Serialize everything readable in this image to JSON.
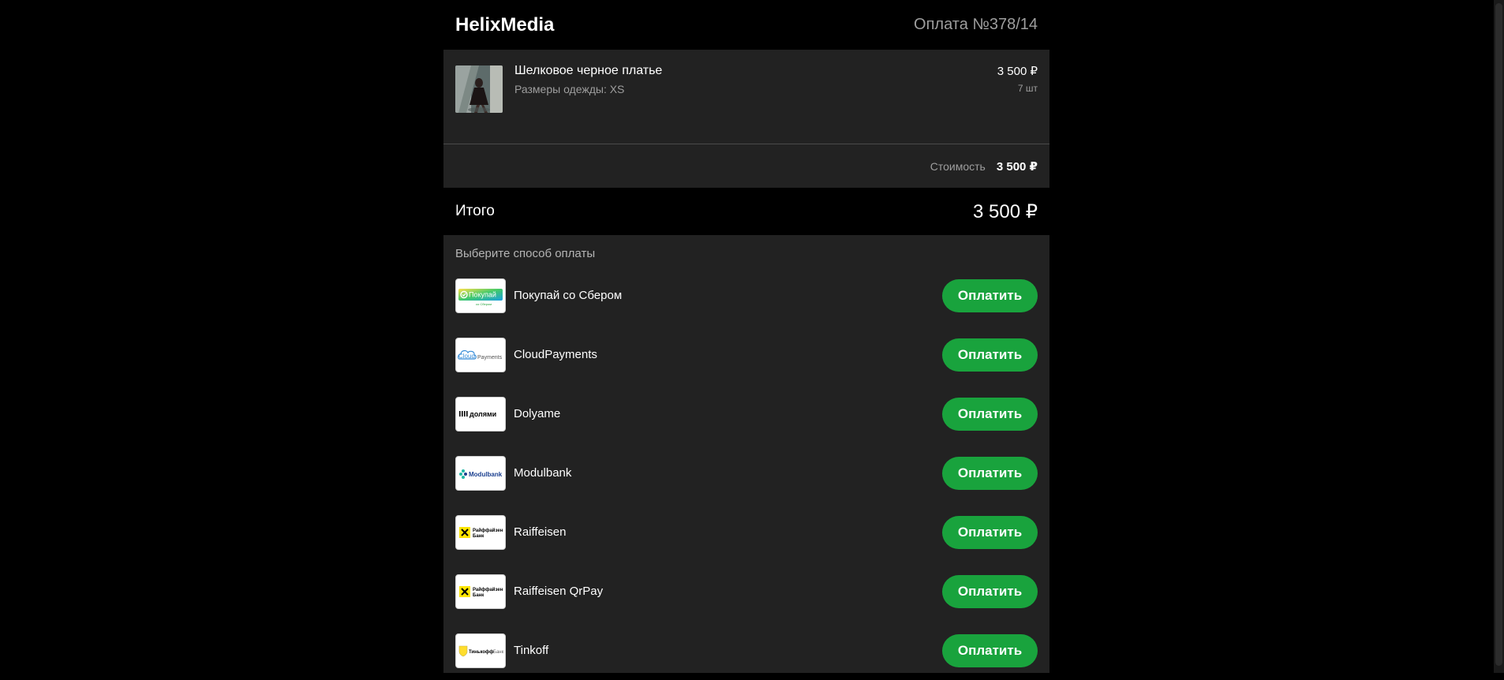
{
  "header": {
    "brand": "HelixMedia",
    "order_number": "Оплата №378/14"
  },
  "item": {
    "name": "Шелковое черное платье",
    "variant": "Размеры одежды: XS",
    "price": "3 500 ₽",
    "quantity": "7 шт",
    "thumbnail_icon": "dress-photo"
  },
  "cost": {
    "label": "Стоимость",
    "value": "3 500 ₽"
  },
  "total": {
    "label": "Итого",
    "value": "3 500 ₽"
  },
  "payment": {
    "title": "Выберите способ оплаты",
    "button_label": "Оплатить",
    "button_color": "#19a33d",
    "methods": [
      {
        "name": "Покупай со Сбером",
        "logo_text": "Покупай",
        "logo_subtext": "со Сбером",
        "icon": "sber-logo"
      },
      {
        "name": "CloudPayments",
        "logo_text": "Cloud",
        "logo_subtext": "Payments",
        "icon": "cloudpayments-logo"
      },
      {
        "name": "Dolyame",
        "logo_text": "долями",
        "icon": "dolyame-logo"
      },
      {
        "name": "Modulbank",
        "logo_text": "Modulbank",
        "icon": "modulbank-logo"
      },
      {
        "name": "Raiffeisen",
        "logo_text": "Райффайзен",
        "logo_subtext": "Банк",
        "icon": "raiffeisen-logo"
      },
      {
        "name": "Raiffeisen QrPay",
        "logo_text": "Райффайзен",
        "logo_subtext": "Банк",
        "icon": "raiffeisen-logo"
      },
      {
        "name": "Tinkoff",
        "logo_text": "Тинькофф",
        "logo_subtext": "Банк",
        "icon": "tinkoff-logo"
      }
    ]
  },
  "colors": {
    "background": "#000000",
    "panel": "#222222",
    "accent": "#19a33d",
    "muted_text": "#9e9e9e"
  }
}
